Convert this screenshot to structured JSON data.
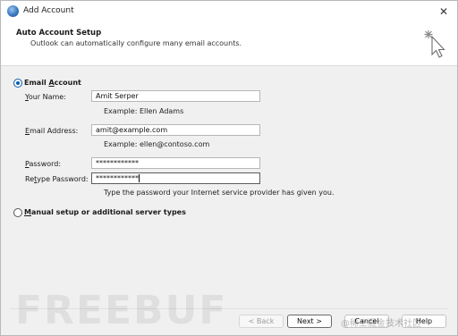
{
  "window": {
    "title": "Add Account",
    "close_glyph": "✕"
  },
  "header": {
    "title": "Auto Account Setup",
    "subtitle": "Outlook can automatically configure many email accounts.",
    "icon": "cursor-sparkle-icon"
  },
  "options": {
    "email_account": {
      "pre": "Email ",
      "underlined": "A",
      "post": "ccount",
      "selected": true
    },
    "manual_setup": {
      "pre": "",
      "underlined": "M",
      "post": "anual setup or additional server types",
      "selected": false
    }
  },
  "form": {
    "name": {
      "label_pre": "",
      "label_u": "Y",
      "label_post": "our Name:",
      "value": "Amit Serper",
      "example": "Example: Ellen Adams"
    },
    "email": {
      "label_pre": "",
      "label_u": "E",
      "label_post": "mail Address:",
      "value": "amit@example.com",
      "example": "Example: ellen@contoso.com"
    },
    "password": {
      "label_pre": "",
      "label_u": "P",
      "label_post": "assword:",
      "value": "************"
    },
    "retype": {
      "label_pre": "Re",
      "label_u": "t",
      "label_post": "ype Password:",
      "value": "************"
    },
    "password_hint": "Type the password your Internet service provider has given you."
  },
  "buttons": {
    "back": "< Back",
    "next": "Next >",
    "cancel": "Cancel",
    "help": "Help"
  },
  "watermark": {
    "logo_text": "FREEBUF",
    "text": "@稀土掘金技术社区"
  }
}
